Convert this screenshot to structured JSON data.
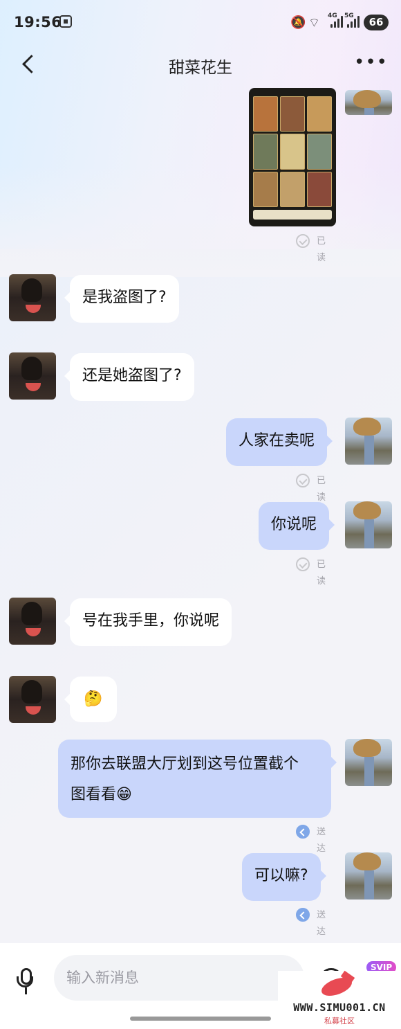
{
  "status_bar": {
    "time": "19:56",
    "network_labels": [
      "4G",
      "5G"
    ],
    "battery": "66"
  },
  "header": {
    "title": "甜菜花生",
    "more": "•••"
  },
  "messages": [
    {
      "side": "right",
      "type": "image",
      "status": "已读"
    },
    {
      "side": "left",
      "text": "是我盗图了?"
    },
    {
      "side": "left",
      "text": "还是她盗图了?"
    },
    {
      "side": "right",
      "text": "人家在卖呢",
      "status": "已读"
    },
    {
      "side": "right",
      "text": "你说呢",
      "status": "已读"
    },
    {
      "side": "left",
      "text": "号在我手里，你说呢"
    },
    {
      "side": "left",
      "text": "🤔"
    },
    {
      "side": "right",
      "lines": [
        "那你去联盟大厅划到这号位置截个",
        "图看看😁"
      ],
      "status": "送达"
    },
    {
      "side": "right",
      "text": "可以嘛?",
      "status": "送达"
    }
  ],
  "composer": {
    "placeholder": "输入新消息",
    "badge": "SVIP"
  },
  "watermark": {
    "url": "WWW.SIMU001.CN",
    "caption": "私募社区"
  },
  "colors": {
    "bubble_mine": "#c9d6fb",
    "bubble_theirs": "#ffffff",
    "background": "#f3f3f8"
  }
}
